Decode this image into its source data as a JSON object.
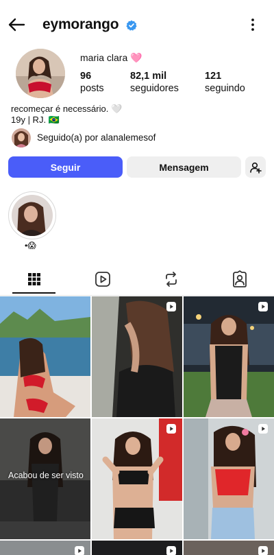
{
  "header": {
    "username": "eymorango",
    "icons": [
      "back-arrow-icon",
      "verified-badge-icon",
      "more-options-icon"
    ]
  },
  "profile": {
    "display_name": "maria clara 🩷",
    "posts_count": "96",
    "posts_label": "posts",
    "followers_count": "82,1 mil",
    "followers_label": "seguidores",
    "following_count": "121",
    "following_label": "seguindo",
    "bio_line1": "recomeçar é necessário. 🤍",
    "bio_line2": "19y | RJ. 🇧🇷",
    "followed_by": "Seguido(a) por alanalemesof"
  },
  "actions": {
    "follow_label": "Seguir",
    "message_label": "Mensagem",
    "accent_color": "#4a5df9"
  },
  "highlights": [
    {
      "label": "•😱"
    }
  ],
  "tabs": [
    "grid-icon",
    "reels-icon",
    "reposts-icon",
    "tagged-icon"
  ],
  "grid": {
    "seen_label": "Acabou de ser visto"
  }
}
